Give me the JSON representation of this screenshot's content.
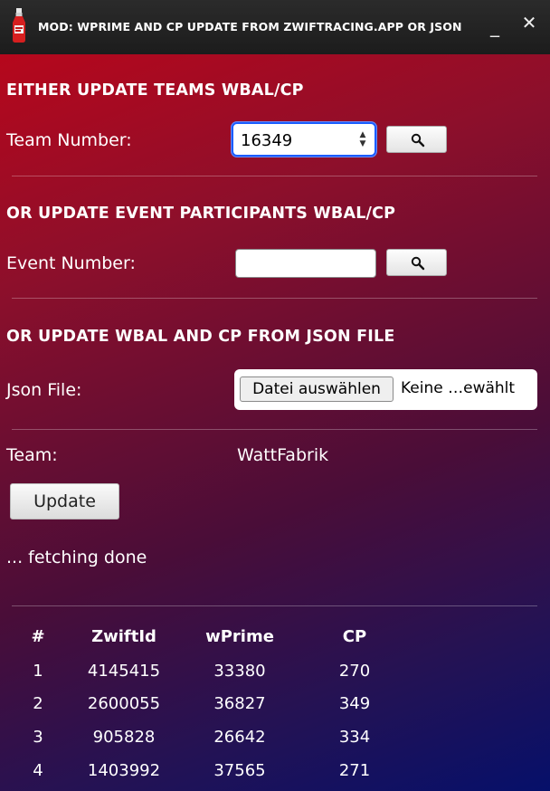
{
  "window": {
    "title": "MOD: WPRIME AND CP UPDATE FROM ZWIFTRACING.APP OR JSON",
    "minimize_glyph": "_",
    "close_glyph": "✕"
  },
  "team_section": {
    "heading": "EITHER UPDATE TEAMS WBAL/CP",
    "label": "Team Number:",
    "value": "16349"
  },
  "event_section": {
    "heading": "OR UPDATE EVENT PARTICIPANTS WBAL/CP",
    "label": "Event Number:",
    "value": ""
  },
  "json_section": {
    "heading": "OR UPDATE WBAL AND CP FROM JSON FILE",
    "label": "Json File:",
    "choose_button": "Datei auswählen",
    "file_status": "Keine …ewählt"
  },
  "team_info": {
    "label": "Team:",
    "value": "WattFabrik"
  },
  "update_button": "Update",
  "status_text": "... fetching done",
  "table": {
    "headers": [
      "#",
      "ZwiftId",
      "wPrime",
      "CP"
    ],
    "rows": [
      [
        "1",
        "4145415",
        "33380",
        "270"
      ],
      [
        "2",
        "2600055",
        "36827",
        "349"
      ],
      [
        "3",
        "905828",
        "26642",
        "334"
      ],
      [
        "4",
        "1403992",
        "37565",
        "271"
      ]
    ]
  },
  "icons": {
    "app": "ketchup-bottle-icon",
    "search": "magnifier-icon",
    "spin": "spin-updown-icon"
  },
  "colors": {
    "focus_border": "#1a5cff",
    "titlebar": "#222222",
    "gradient_start": "#b6071c",
    "gradient_end": "#06106a"
  }
}
